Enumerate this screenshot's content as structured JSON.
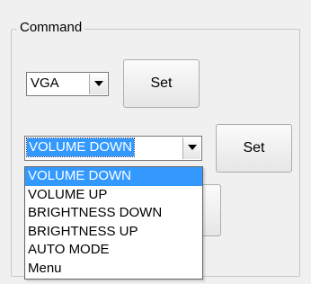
{
  "group": {
    "title": "Command"
  },
  "input_combo": {
    "value": "VGA"
  },
  "input_set_button": {
    "label": "Set"
  },
  "command_combo": {
    "value": "VOLUME DOWN"
  },
  "command_set_button": {
    "label": "Set"
  },
  "dropdown": {
    "items": [
      "VOLUME DOWN",
      "VOLUME UP",
      "BRIGHTNESS DOWN",
      "BRIGHTNESS UP",
      "AUTO MODE",
      "Menu"
    ],
    "highlighted_index": 0
  },
  "colors": {
    "selection": "#3399ff",
    "background": "#f0f0f0"
  }
}
